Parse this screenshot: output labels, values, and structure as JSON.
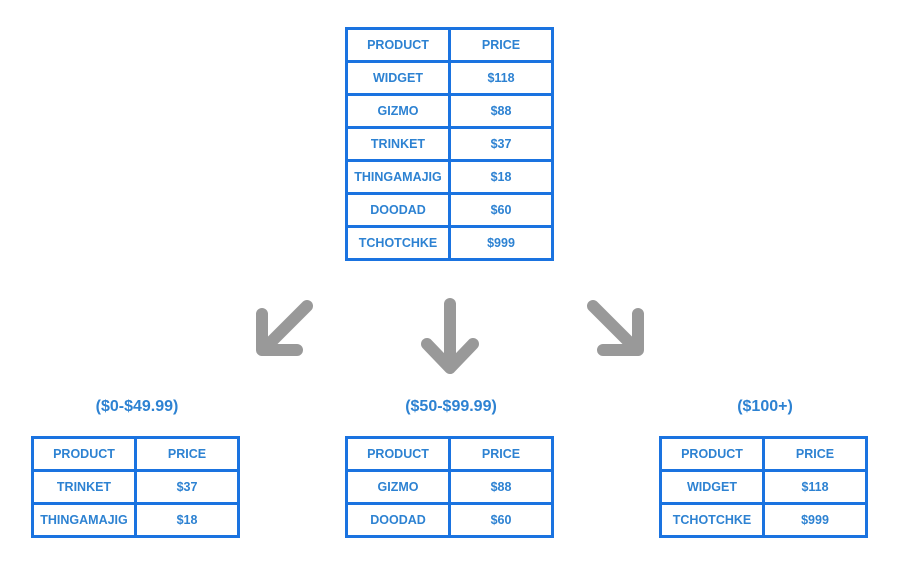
{
  "colors": {
    "border": "#1a73e0",
    "text": "#2d82d2",
    "arrow": "#999999"
  },
  "headers": {
    "product": "PRODUCT",
    "price": "PRICE"
  },
  "source_table": {
    "rows": [
      {
        "product": "WIDGET",
        "price": "$118"
      },
      {
        "product": "GIZMO",
        "price": "$88"
      },
      {
        "product": "TRINKET",
        "price": "$37"
      },
      {
        "product": "THINGAMAJIG",
        "price": "$18"
      },
      {
        "product": "DOODAD",
        "price": "$60"
      },
      {
        "product": "TCHOTCHKE",
        "price": "$999"
      }
    ]
  },
  "arrows": [
    {
      "direction": "down-left",
      "icon": "arrow-down-left-icon"
    },
    {
      "direction": "down",
      "icon": "arrow-down-icon"
    },
    {
      "direction": "down-right",
      "icon": "arrow-down-right-icon"
    }
  ],
  "buckets": [
    {
      "label": "($0-$49.99)",
      "rows": [
        {
          "product": "TRINKET",
          "price": "$37"
        },
        {
          "product": "THINGAMAJIG",
          "price": "$18"
        }
      ]
    },
    {
      "label": "($50-$99.99)",
      "rows": [
        {
          "product": "GIZMO",
          "price": "$88"
        },
        {
          "product": "DOODAD",
          "price": "$60"
        }
      ]
    },
    {
      "label": "($100+)",
      "rows": [
        {
          "product": "WIDGET",
          "price": "$118"
        },
        {
          "product": "TCHOTCHKE",
          "price": "$999"
        }
      ]
    }
  ]
}
